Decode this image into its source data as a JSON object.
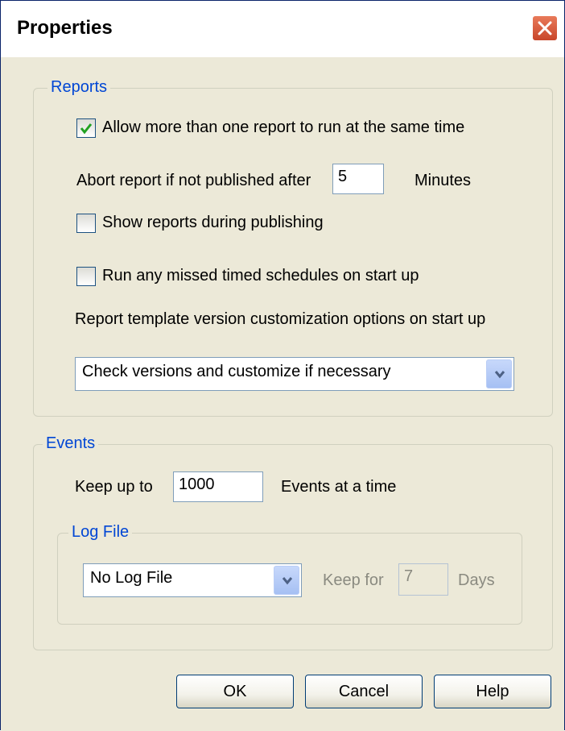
{
  "window": {
    "title": "Properties"
  },
  "reports": {
    "legend": "Reports",
    "allow_multiple": {
      "label": "Allow more than one report to run at the same time",
      "checked": true
    },
    "abort": {
      "prefix": "Abort report if not published after",
      "value": "5",
      "suffix": "Minutes"
    },
    "show_reports": {
      "label": "Show reports during publishing",
      "checked": false
    },
    "run_missed": {
      "label": "Run any missed timed schedules on start up",
      "checked": false
    },
    "template_label": "Report template version customization options on start up",
    "template_select": {
      "value": "Check versions and customize if necessary"
    }
  },
  "events": {
    "legend": "Events",
    "keep_prefix": "Keep up to",
    "keep_value": "1000",
    "keep_suffix": "Events at a time",
    "logfile": {
      "legend": "Log File",
      "select_value": "No Log File",
      "keep_for_label": "Keep for",
      "days_value": "7",
      "days_label": "Days"
    }
  },
  "buttons": {
    "ok": "OK",
    "cancel": "Cancel",
    "help": "Help"
  },
  "colors": {
    "accent": "#0046d5",
    "check": "#21a121",
    "dialog_bg": "#ece9d8"
  }
}
